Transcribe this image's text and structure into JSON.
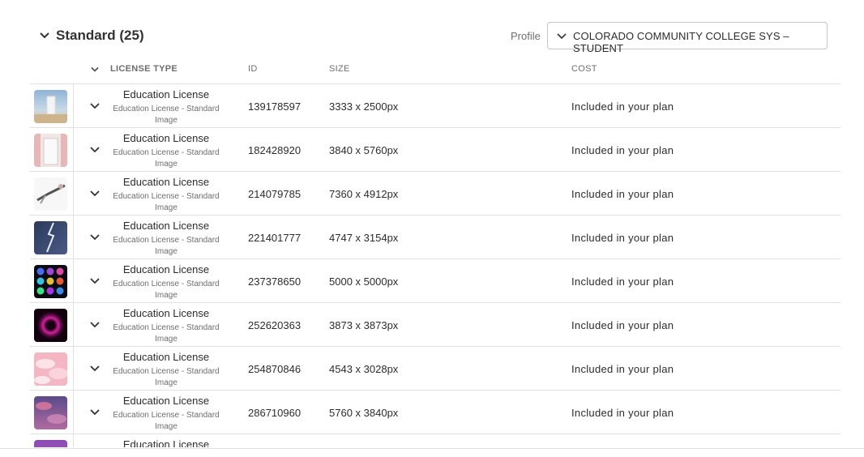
{
  "section": {
    "title": "Standard (25)"
  },
  "profile": {
    "label": "Profile",
    "value": "COLORADO COMMUNITY COLLEGE SYS – STUDENT"
  },
  "columns": {
    "license_type": "LICENSE TYPE",
    "id": "ID",
    "size": "SIZE",
    "cost": "COST"
  },
  "rows": [
    {
      "title": "Education License",
      "subtitle": "Education License - Standard Image",
      "id": "139178597",
      "size": "3333 x 2500px",
      "cost": "Included in your plan",
      "thumb": "door-in-desert"
    },
    {
      "title": "Education License",
      "subtitle": "Education License - Standard Image",
      "id": "182428920",
      "size": "3840 x 5760px",
      "cost": "Included in your plan",
      "thumb": "open-door-pink"
    },
    {
      "title": "Education License",
      "subtitle": "Education License - Standard Image",
      "id": "214079785",
      "size": "7360 x 4912px",
      "cost": "Included in your plan",
      "thumb": "falling-person"
    },
    {
      "title": "Education License",
      "subtitle": "Education License - Standard Image",
      "id": "221401777",
      "size": "4747 x 3154px",
      "cost": "Included in your plan",
      "thumb": "lightning"
    },
    {
      "title": "Education License",
      "subtitle": "Education License - Standard Image",
      "id": "237378650",
      "size": "5000 x 5000px",
      "cost": "Included in your plan",
      "thumb": "colored-spheres"
    },
    {
      "title": "Education License",
      "subtitle": "Education License - Standard Image",
      "id": "252620363",
      "size": "3873 x 3873px",
      "cost": "Included in your plan",
      "thumb": "glowing-ring"
    },
    {
      "title": "Education License",
      "subtitle": "Education License - Standard Image",
      "id": "254870846",
      "size": "4543 x 3028px",
      "cost": "Included in your plan",
      "thumb": "pink-clouds"
    },
    {
      "title": "Education License",
      "subtitle": "Education License - Standard Image",
      "id": "286710960",
      "size": "5760 x 3840px",
      "cost": "Included in your plan",
      "thumb": "purple-sky"
    },
    {
      "title": "Education License",
      "subtitle": "",
      "id": "",
      "size": "",
      "cost": "",
      "thumb": "purple-sky-partial"
    }
  ]
}
